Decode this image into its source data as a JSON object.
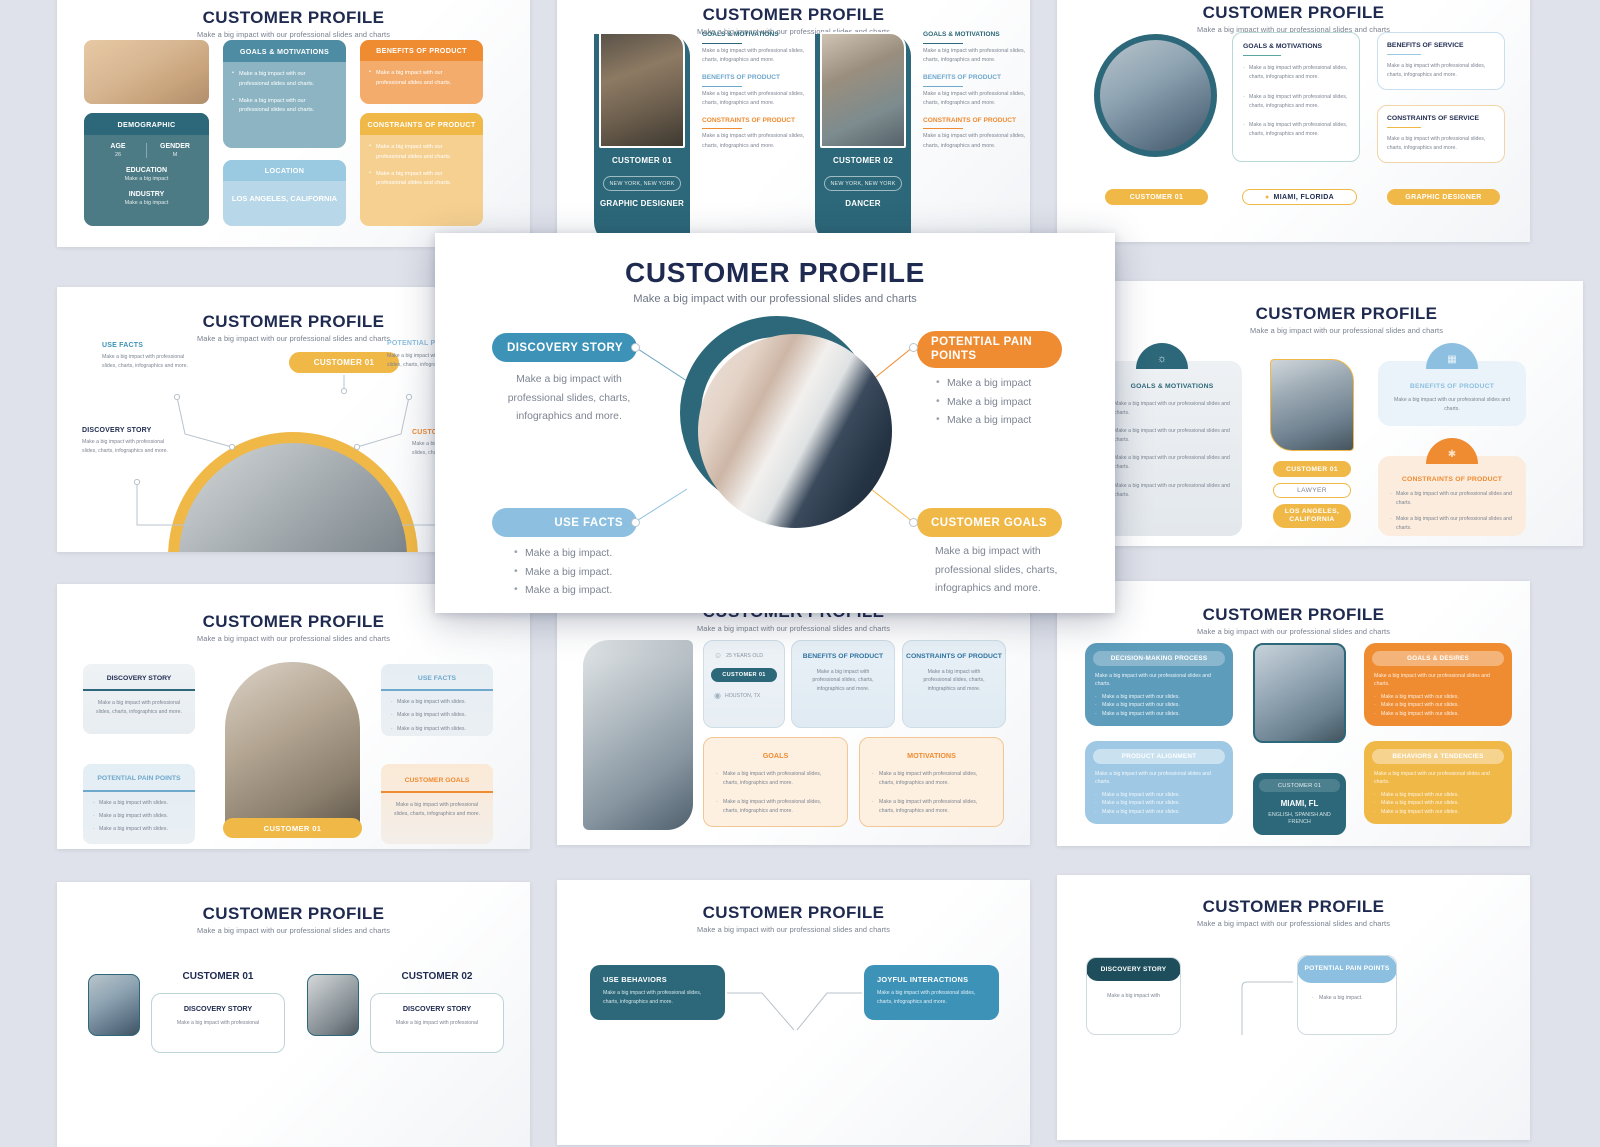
{
  "background_color": "#dfe2ea",
  "common": {
    "title": "CUSTOMER PROFILE",
    "subtitle": "Make a big impact with our professional slides and charts",
    "body_short": "Make a big impact with our professional slides and charts.",
    "body_long": "Make a big impact with professional slides, charts, infographics and more.",
    "bullet_slides": "Make a big impact with slides.",
    "bullet_our_slides": "Make a big impact with our slides.",
    "bullet_impact": "Make a big impact",
    "bullet_impact_dot": "Make a big impact."
  },
  "modal": {
    "title": "CUSTOMER PROFILE",
    "subtitle": "Make a big impact with our professional slides and charts",
    "nodes": [
      {
        "id": "discovery-story",
        "label": "DISCOVERY STORY",
        "color": "#3d92b8",
        "body": "Make a big impact with professional slides, charts, infographics and more."
      },
      {
        "id": "potential-pain-points",
        "label": "POTENTIAL PAIN POINTS",
        "color": "#ef8b31",
        "bullets": [
          "Make a big impact",
          "Make a big impact",
          "Make a big impact"
        ]
      },
      {
        "id": "use-facts",
        "label": "USE FACTS",
        "color": "#8dc0e0",
        "bullets": [
          "Make a big impact.",
          "Make a big impact.",
          "Make a big impact."
        ]
      },
      {
        "id": "customer-goals",
        "label": "CUSTOMER GOALS",
        "color": "#f0b847",
        "body": "Make a big impact with professional slides, charts, infographics and more."
      }
    ]
  },
  "slides": [
    {
      "id": "slide-1",
      "title": "CUSTOMER PROFILE",
      "subtitle": "Make a big impact with our professional slides and charts",
      "demographic": {
        "header": "DEMOGRAPHIC",
        "age_label": "AGE",
        "age_value": "26",
        "gender_label": "GENDER",
        "gender_value": "M",
        "education_label": "EDUCATION",
        "education_value": "Make a big impact",
        "industry_label": "INDUSTRY",
        "industry_value": "Make a big impact"
      },
      "goals": {
        "header": "GOALS & MOTIVATIONS",
        "bullets": [
          "Make a big impact with our professional slides and charts.",
          "Make a big impact with our professional slides and charts."
        ]
      },
      "location": {
        "header": "LOCATION",
        "value": "LOS ANGELES, CALIFORNIA"
      },
      "benefits": {
        "header": "BENEFITS OF PRODUCT",
        "bullets": [
          "Make a big impact with our professional slides and charts."
        ]
      },
      "constraints": {
        "header": "CONSTRAINTS OF PRODUCT",
        "bullets": [
          "Make a big impact with our professional slides and charts.",
          "Make a big impact with our professional slides and charts."
        ]
      }
    },
    {
      "id": "slide-2",
      "title": "CUSTOMER PROFILE",
      "subtitle": "Make a big impact with our professional slides and charts",
      "customers": [
        {
          "name": "CUSTOMER 01",
          "location": "NEW YORK, NEW YORK",
          "role": "GRAPHIC DESIGNER"
        },
        {
          "name": "CUSTOMER 02",
          "location": "NEW YORK, NEW YORK",
          "role": "DANCER"
        }
      ],
      "sections": [
        {
          "header": "GOALS & MOTIVATIONS",
          "color": "#2c6879",
          "body": "Make a big impact with professional slides, charts, infographics and more."
        },
        {
          "header": "BENEFITS OF PRODUCT",
          "color": "#6fa8cd",
          "body": "Make a big impact with professional slides, charts, infographics and more."
        },
        {
          "header": "CONSTRAINTS OF PRODUCT",
          "color": "#ef8b31",
          "body": "Make a big impact with professional slides, charts, infographics and more."
        }
      ]
    },
    {
      "id": "slide-3",
      "title": "CUSTOMER PROFILE",
      "subtitle": "Make a big impact with our professional slides and charts",
      "goals": {
        "header": "GOALS & MOTIVATIONS",
        "bullets": [
          "Make a big impact with professional slides, charts, infographics and more.",
          "Make a big impact with professional slides, charts, infographics and more.",
          "Make a big impact with professional slides, charts, infographics and more."
        ]
      },
      "benefits": {
        "header": "BENEFITS OF SERVICE",
        "body": "Make a big impact with professional slides, charts, infographics and more."
      },
      "constraints": {
        "header": "CONSTRAINTS OF SERVICE",
        "body": "Make a big impact with professional slides, charts, infographics and more."
      },
      "tags": {
        "customer": "CUSTOMER 01",
        "location": "MIAMI, FLORIDA",
        "role": "GRAPHIC DESIGNER"
      }
    },
    {
      "id": "slide-4",
      "title": "CUSTOMER PROFILE",
      "subtitle": "Make a big impact with our professional slides and charts",
      "center_pill": "CUSTOMER 01",
      "nodes": [
        {
          "label": "USE FACTS",
          "color": "#3d92b8",
          "body": "Make a big impact with professional slides, charts, infographics and more."
        },
        {
          "label": "POTENTIAL PAIN POINTS",
          "color": "#8dc0e0",
          "body": "Make a big impact with professional slides, charts, infographics and more."
        },
        {
          "label": "DISCOVERY STORY",
          "color": "#1e2a4f",
          "body": "Make a big impact with professional slides, charts, infographics and more."
        },
        {
          "label": "CUSTOMER GOALS",
          "color": "#ef8b31",
          "body": "Make a big impact with professional slides, charts, infographics and more."
        }
      ]
    },
    {
      "id": "slide-5",
      "title": "CUSTOMER PROFILE",
      "subtitle": "Make a big impact with our professional slides and charts",
      "goals": {
        "header": "GOALS & MOTIVATIONS",
        "icon": "lightbulb-icon",
        "bullets": [
          "Make a big impact with our professional slides and charts.",
          "Make a big impact with our professional slides and charts.",
          "Make a big impact with our professional slides and charts.",
          "Make a big impact with our professional slides and charts."
        ]
      },
      "benefits": {
        "header": "BENEFITS OF PRODUCT",
        "icon": "chart-icon",
        "body": "Make a big impact with our professional slides and charts."
      },
      "constraints": {
        "header": "CONSTRAINTS OF PRODUCT",
        "icon": "gear-icon",
        "bullets": [
          "Make a big impact with our professional slides and charts.",
          "Make a big impact with our professional slides and charts."
        ]
      },
      "tags": {
        "customer": "CUSTOMER 01",
        "role": "LAWYER",
        "location": "LOS ANGELES, CALIFORNIA"
      }
    },
    {
      "id": "slide-6",
      "title": "CUSTOMER PROFILE",
      "subtitle": "Make a big impact with our professional slides and charts",
      "center_pill": "CUSTOMER 01",
      "cards": [
        {
          "header": "DISCOVERY STORY",
          "color": "#2c6879",
          "body": "Make a big impact with professional slides, charts, infographics and more."
        },
        {
          "header": "USE FACTS",
          "color": "#6fa8cd",
          "bullets": [
            "Make a big impact with slides.",
            "Make a big impact with slides.",
            "Make a big impact with slides."
          ]
        },
        {
          "header": "POTENTIAL PAIN POINTS",
          "color": "#6fa8cd",
          "bullets": [
            "Make a big impact with slides.",
            "Make a big impact with slides.",
            "Make a big impact with slides."
          ]
        },
        {
          "header": "CUSTOMER GOALS",
          "color": "#ef8b31",
          "body": "Make a big impact with professional slides, charts, infographics and more."
        }
      ]
    },
    {
      "id": "slide-7",
      "title": "CUSTOMER PROFILE",
      "subtitle": "Make a big impact with our professional slides and charts",
      "facts": {
        "age": "25 YEARS OLD",
        "customer": "CUSTOMER 01",
        "location": "HOUSTON, TX",
        "age_icon": "person-icon",
        "location_icon": "map-pin-icon"
      },
      "benefits": {
        "header": "BENEFITS OF PRODUCT",
        "body": "Make a big impact with professional slides, charts, infographics and more."
      },
      "constraints": {
        "header": "CONSTRAINTS OF PRODUCT",
        "body": "Make a big impact with professional slides, charts, infographics and more."
      },
      "goals": {
        "header": "GOALS",
        "bullets": [
          "Make a big impact with professional slides, charts, infographics and more.",
          "Make a big impact with professional slides, charts, infographics and more."
        ]
      },
      "motivations": {
        "header": "MOTIVATIONS",
        "bullets": [
          "Make a big impact with professional slides, charts, infographics and more.",
          "Make a big impact with professional slides, charts, infographics and more."
        ]
      }
    },
    {
      "id": "slide-8",
      "title": "CUSTOMER PROFILE",
      "subtitle": "Make a big impact with our professional slides and charts",
      "cards": [
        {
          "header": "DECISION-MAKING PROCESS",
          "color": "#5d9cbb",
          "body": "Make a big impact with our professional slides and charts.",
          "bullets": [
            "Make a big impact with our slides.",
            "Make a big impact with our slides.",
            "Make a big impact with our slides."
          ]
        },
        {
          "header": "PRODUCT ALIGNMENT",
          "color": "#9ec8e3",
          "body": "Make a big impact with our professional slides and charts.",
          "bullets": [
            "Make a big impact with our slides.",
            "Make a big impact with our slides.",
            "Make a big impact with our slides."
          ]
        },
        {
          "header": "GOALS & DESIRES",
          "color": "#ef8b31",
          "body": "Make a big impact with our professional slides and charts.",
          "bullets": [
            "Make a big impact with our slides.",
            "Make a big impact with our slides.",
            "Make a big impact with our slides."
          ]
        },
        {
          "header": "BEHAVIORS & TENDENCIES",
          "color": "#f0b847",
          "body": "Make a big impact with our professional slides and charts.",
          "bullets": [
            "Make a big impact with our slides.",
            "Make a big impact with our slides.",
            "Make a big impact with our slides."
          ]
        }
      ],
      "info": {
        "customer": "CUSTOMER 01",
        "location": "MIAMI, FL",
        "languages": "ENGLISH, SPANISH AND FRENCH"
      }
    },
    {
      "id": "slide-9",
      "title": "CUSTOMER PROFILE",
      "subtitle": "Make a big impact with our professional slides and charts",
      "customers": [
        {
          "name": "CUSTOMER 01",
          "section": "DISCOVERY STORY",
          "body": "Make a big impact with professional"
        },
        {
          "name": "CUSTOMER 02",
          "section": "DISCOVERY STORY",
          "body": "Make a big impact with professional"
        }
      ]
    },
    {
      "id": "slide-10",
      "title": "CUSTOMER PROFILE",
      "subtitle": "Make a big impact with our professional slides and charts",
      "cards": [
        {
          "header": "USE BEHAVIORS",
          "color": "#2c6879",
          "body": "Make a big impact with professional slides, charts, infographics and more."
        },
        {
          "header": "JOYFUL INTERACTIONS",
          "color": "#3d92b8",
          "body": "Make a big impact with professional slides, charts, infographics and more."
        }
      ]
    },
    {
      "id": "slide-11",
      "title": "CUSTOMER PROFILE",
      "subtitle": "Make a big impact with our professional slides and charts",
      "cards": [
        {
          "header": "DISCOVERY STORY",
          "color": "#1e4e5c",
          "body": "Make a big impact with"
        },
        {
          "header": "POTENTIAL PAIN POINTS",
          "color": "#8dc0e0",
          "bullets": [
            "Make a big impact."
          ]
        }
      ]
    }
  ]
}
